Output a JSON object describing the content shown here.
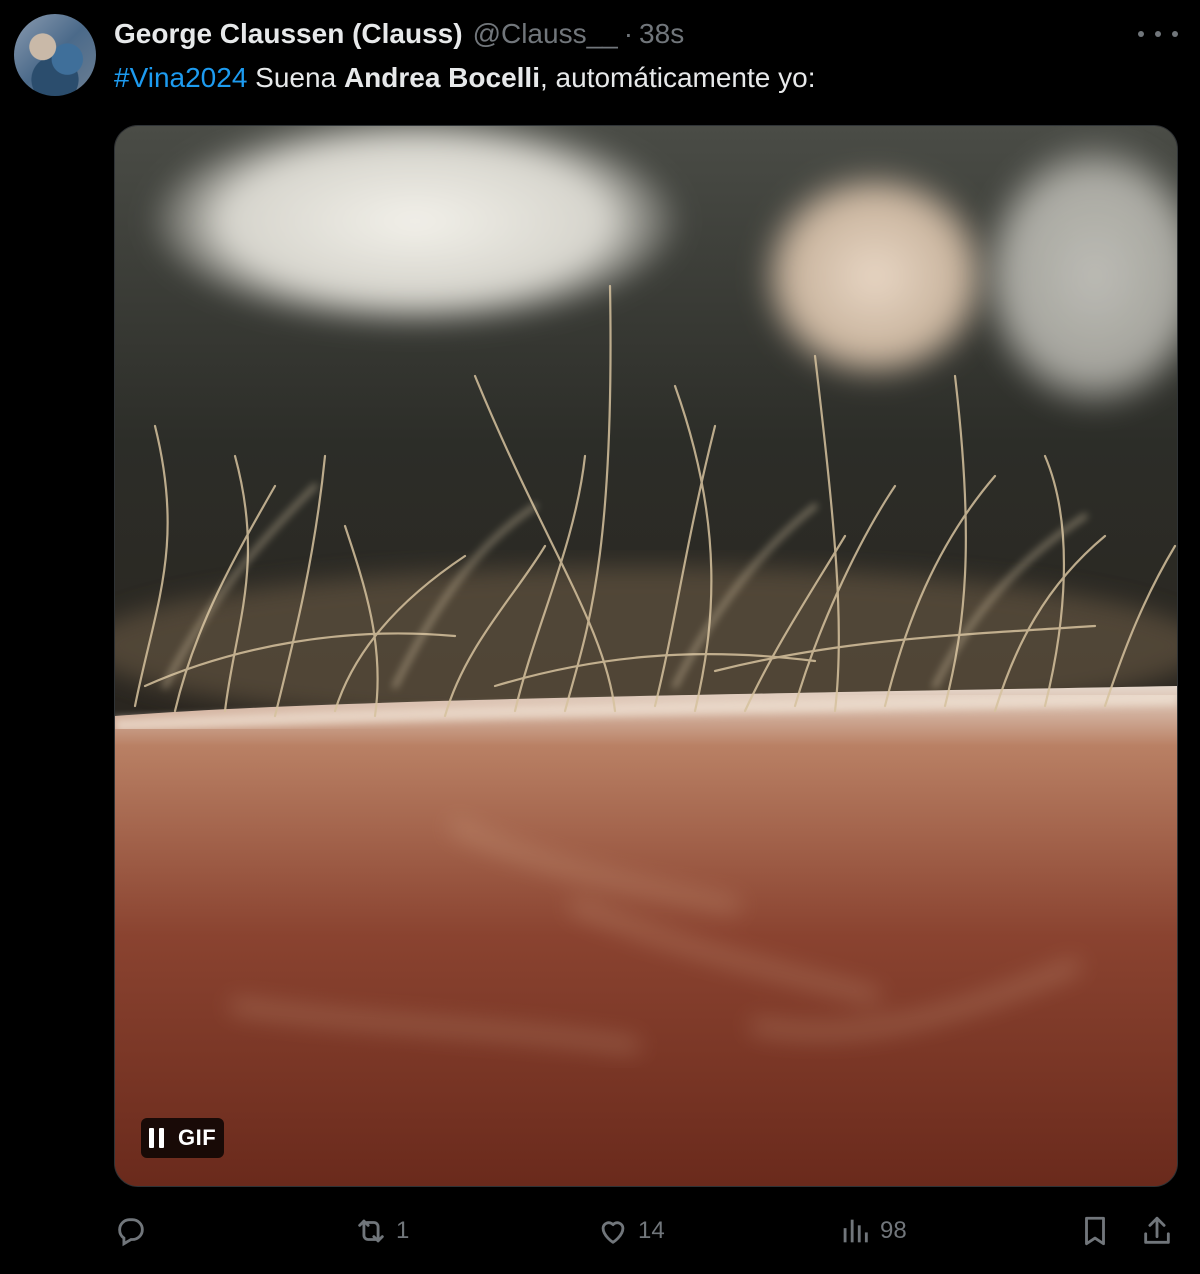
{
  "tweet": {
    "display_name": "George Claussen (Clauss)",
    "handle": "@Clauss__",
    "separator": "·",
    "time": "38s",
    "text": {
      "hashtag": "#Vina2024",
      "part1": " Suena ",
      "bold": "Andrea Bocelli",
      "part2": ", automáticamente yo:"
    },
    "media": {
      "badge_label": "GIF",
      "playback": "playing"
    },
    "actions": {
      "reply_count": "",
      "retweet_count": "1",
      "like_count": "14",
      "view_count": "98"
    }
  },
  "colors": {
    "background": "#000000",
    "text": "#e7e9ea",
    "muted": "#71767b",
    "link": "#1d9bf0"
  },
  "icons": [
    "more-icon",
    "pause-icon",
    "reply-icon",
    "retweet-icon",
    "like-icon",
    "views-icon",
    "bookmark-icon",
    "share-icon"
  ]
}
